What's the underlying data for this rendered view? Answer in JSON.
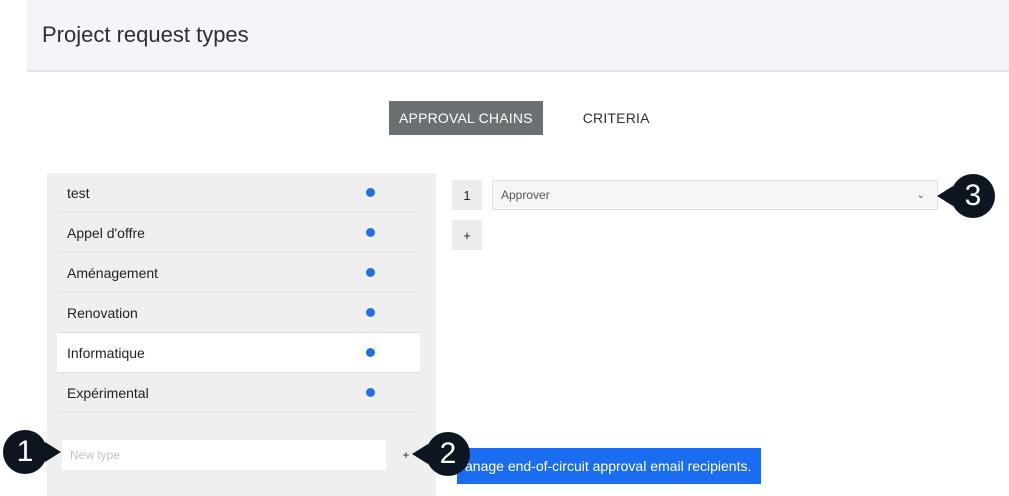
{
  "header": {
    "title": "Project request types"
  },
  "tabs": [
    {
      "label": "APPROVAL CHAINS",
      "active": true
    },
    {
      "label": "CRITERIA",
      "active": false
    }
  ],
  "types": {
    "items": [
      {
        "label": "test",
        "selected": false
      },
      {
        "label": "Appel d'offre",
        "selected": false
      },
      {
        "label": "Aménagement",
        "selected": false
      },
      {
        "label": "Renovation",
        "selected": false
      },
      {
        "label": "Informatique",
        "selected": true
      },
      {
        "label": "Expérimental",
        "selected": false
      }
    ],
    "new_type_placeholder": "New type",
    "add_label": "+"
  },
  "chain": {
    "steps": [
      {
        "number": "1",
        "approver_placeholder": "Approver"
      }
    ],
    "add_step_label": "+"
  },
  "manage_button_label": "anage end-of-circuit approval email recipients.",
  "callouts": [
    "1",
    "2",
    "3"
  ],
  "colors": {
    "accent": "#1a6cf0",
    "dot": "#1f6fe6",
    "tab_active": "#6b7073",
    "callout": "#0d1521"
  },
  "icons": {
    "select_chevron": "chevron-down-icon",
    "status_dot": "status-dot-icon"
  }
}
